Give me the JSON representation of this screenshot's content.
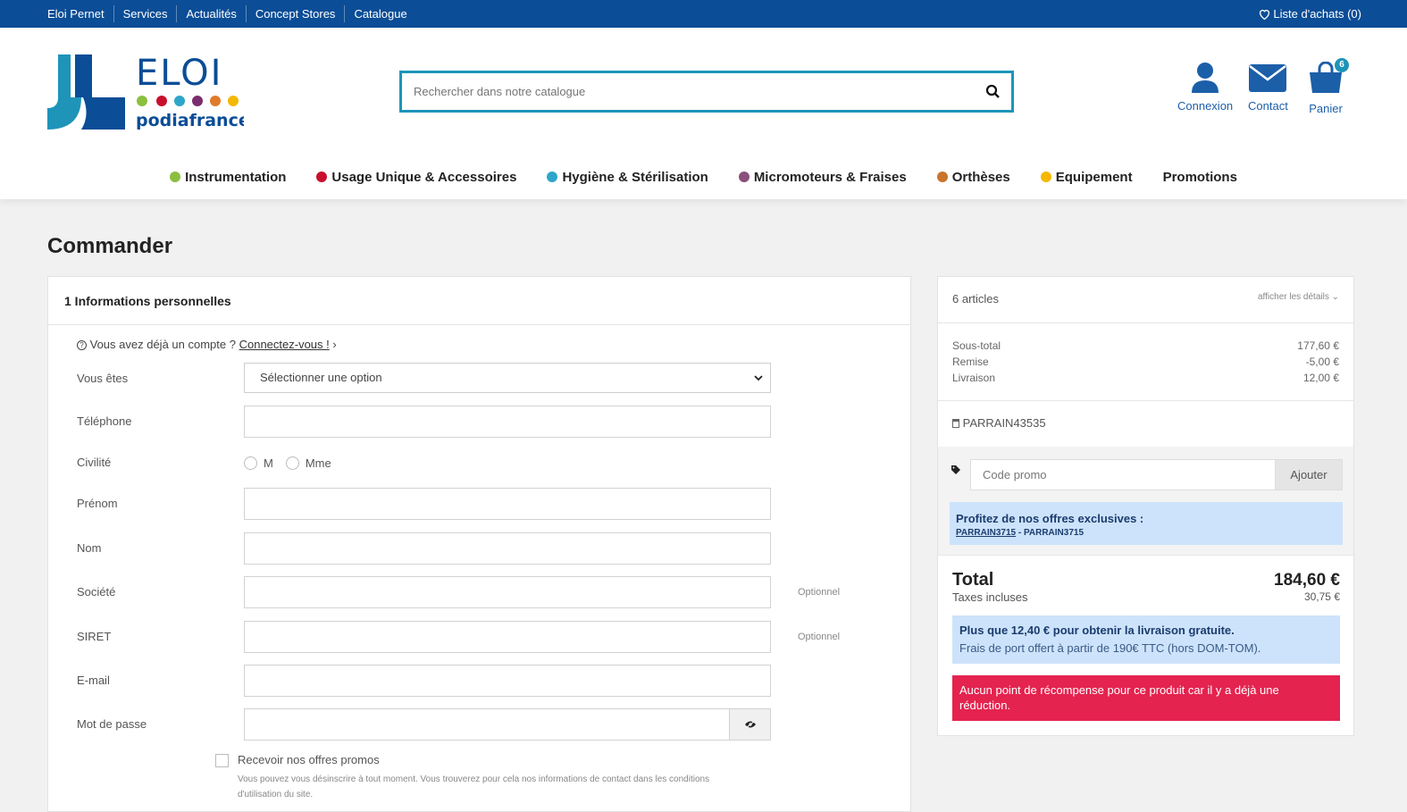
{
  "topbar": {
    "links": [
      "Eloi Pernet",
      "Services",
      "Actualités",
      "Concept Stores",
      "Catalogue"
    ],
    "wishlist": "Liste d'achats (0)"
  },
  "brand": {
    "name": "ELOI",
    "sub": "podiafrance",
    "colors": [
      "#1e94b9",
      "#0b4d96",
      "#8bbf3f",
      "#c8102e",
      "#2ea6c9",
      "#7b2c6e",
      "#e07b2a",
      "#f5b800"
    ]
  },
  "search": {
    "placeholder": "Rechercher dans notre catalogue",
    "icon": "search-icon"
  },
  "header_icons": {
    "login": "Connexion",
    "contact": "Contact",
    "cart": "Panier",
    "cart_count": "6"
  },
  "nav": [
    {
      "label": "Instrumentation",
      "color": "#8bbf3f"
    },
    {
      "label": "Usage Unique & Accessoires",
      "color": "#c8102e"
    },
    {
      "label": "Hygiène & Stérilisation",
      "color": "#2ea6c9"
    },
    {
      "label": "Micromoteurs & Fraises",
      "color": "#8a4f7d"
    },
    {
      "label": "Orthèses",
      "color": "#c9742a"
    },
    {
      "label": "Equipement",
      "color": "#f5b800"
    },
    {
      "label": "Promotions",
      "color": ""
    }
  ],
  "page": {
    "title": "Commander"
  },
  "form": {
    "step_title": "1 Informations personnelles",
    "login_prompt": "Vous avez déjà un compte ?",
    "login_link": "Connectez-vous !",
    "fields": {
      "vous_etes": {
        "label": "Vous êtes",
        "value": "Sélectionner une option"
      },
      "telephone": {
        "label": "Téléphone",
        "value": ""
      },
      "civilite": {
        "label": "Civilité",
        "options": [
          "M",
          "Mme"
        ]
      },
      "prenom": {
        "label": "Prénom",
        "value": ""
      },
      "nom": {
        "label": "Nom",
        "value": ""
      },
      "societe": {
        "label": "Société",
        "value": "",
        "optional": "Optionnel"
      },
      "siret": {
        "label": "SIRET",
        "value": "",
        "optional": "Optionnel"
      },
      "email": {
        "label": "E-mail",
        "value": ""
      },
      "password": {
        "label": "Mot de passe",
        "value": ""
      }
    },
    "newsletter": {
      "label": "Recevoir nos offres promos",
      "note": "Vous pouvez vous désinscrire à tout moment. Vous trouverez pour cela nos informations de contact dans les conditions d'utilisation du site."
    }
  },
  "summary": {
    "items_count": "6 articles",
    "details_link": "afficher les détails",
    "subtotal_label": "Sous-total",
    "subtotal": "177,60 €",
    "discount_label": "Remise",
    "discount": "-5,00 €",
    "shipping_label": "Livraison",
    "shipping": "12,00 €",
    "voucher": "PARRAIN43535",
    "promo_placeholder": "Code promo",
    "promo_button": "Ajouter",
    "offers_title": "Profitez de nos offres exclusives :",
    "offers_code_link": "PARRAIN3715",
    "offers_code_text": " - PARRAIN3715",
    "total_label": "Total",
    "total": "184,60 €",
    "tax_label": "Taxes incluses",
    "tax": "30,75 €",
    "free_shipping_title": "Plus que 12,40 € pour obtenir la livraison gratuite.",
    "free_shipping_text": "Frais de port offert à partir de 190€ TTC (hors DOM-TOM).",
    "reward_alert": "Aucun point de récompense pour ce produit car il y a déjà une réduction."
  }
}
